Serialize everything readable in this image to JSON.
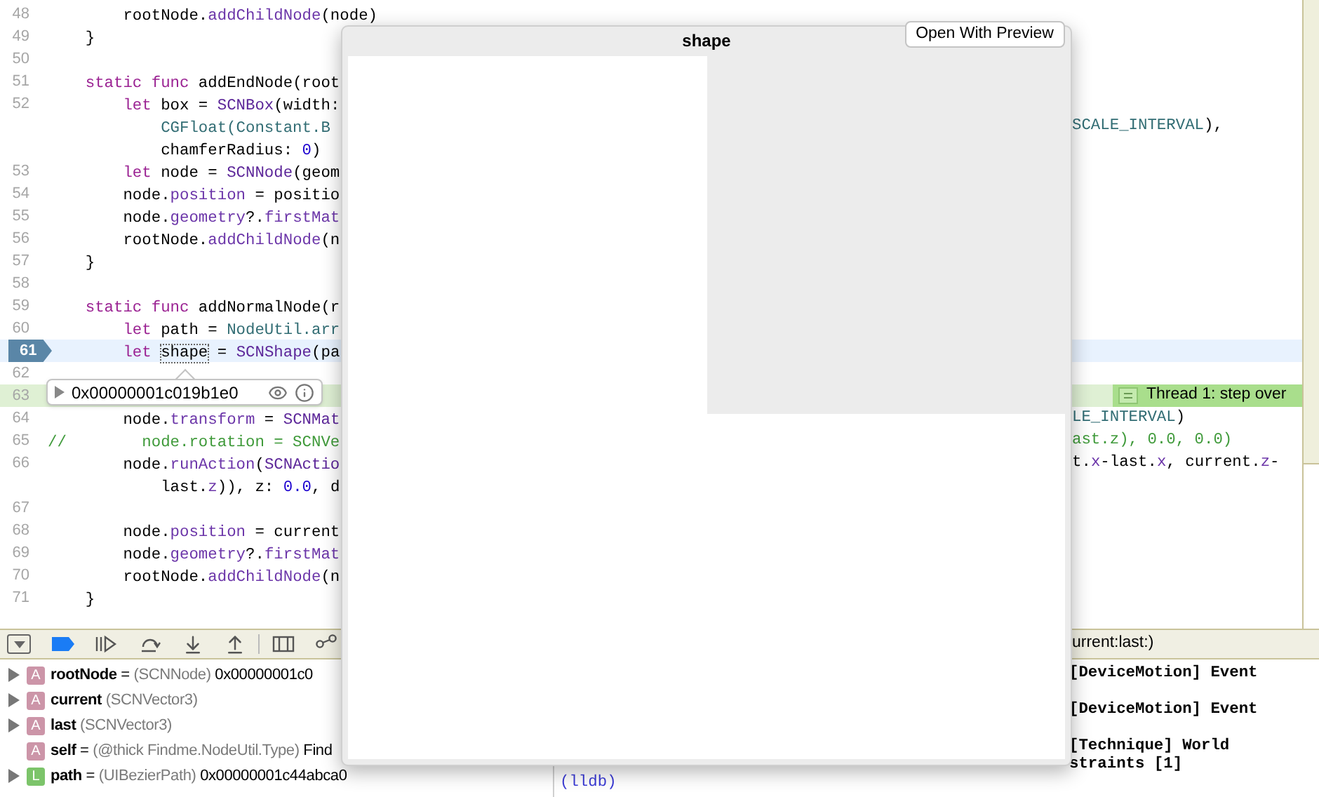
{
  "editor": {
    "lines": [
      {
        "number": "48",
        "code": [
          {
            "kind": "plain",
            "t": "        rootNode."
          },
          {
            "kind": "member",
            "t": "addChildNode"
          },
          {
            "kind": "plain",
            "t": "(node)"
          }
        ]
      },
      {
        "number": "49",
        "code": [
          {
            "kind": "plain",
            "t": "    }"
          }
        ]
      },
      {
        "number": "50"
      },
      {
        "number": "51",
        "code": [
          {
            "kind": "keyword",
            "t": "    static func"
          },
          {
            "kind": "plain",
            "t": " addEndNode(root"
          }
        ]
      },
      {
        "number": "52",
        "code": [
          {
            "kind": "keyword",
            "t": "        let"
          },
          {
            "kind": "plain",
            "t": " box = "
          },
          {
            "kind": "type",
            "t": "SCNBox"
          },
          {
            "kind": "plain",
            "t": "(width:"
          }
        ]
      },
      {
        "code": [
          {
            "kind": "project",
            "t": "            CGFloat(Constant.B"
          }
        ],
        "right": [
          {
            "kind": "project",
            "t": "SCALE_INTERVAL"
          },
          {
            "kind": "plain",
            "t": "),"
          }
        ]
      },
      {
        "code": [
          {
            "kind": "plain",
            "t": "            chamferRadius: "
          },
          {
            "kind": "number",
            "t": "0"
          },
          {
            "kind": "plain",
            "t": ")"
          }
        ]
      },
      {
        "number": "53",
        "code": [
          {
            "kind": "keyword",
            "t": "        let"
          },
          {
            "kind": "plain",
            "t": " node = "
          },
          {
            "kind": "type",
            "t": "SCNNode"
          },
          {
            "kind": "plain",
            "t": "(geom"
          }
        ]
      },
      {
        "number": "54",
        "code": [
          {
            "kind": "plain",
            "t": "        node."
          },
          {
            "kind": "member",
            "t": "position"
          },
          {
            "kind": "plain",
            "t": " = positio"
          }
        ]
      },
      {
        "number": "55",
        "code": [
          {
            "kind": "plain",
            "t": "        node."
          },
          {
            "kind": "member",
            "t": "geometry"
          },
          {
            "kind": "plain",
            "t": "?."
          },
          {
            "kind": "member",
            "t": "firstMat"
          }
        ]
      },
      {
        "number": "56",
        "code": [
          {
            "kind": "plain",
            "t": "        rootNode."
          },
          {
            "kind": "member",
            "t": "addChildNode"
          },
          {
            "kind": "plain",
            "t": "(n"
          }
        ]
      },
      {
        "number": "57",
        "code": [
          {
            "kind": "plain",
            "t": "    }"
          }
        ]
      },
      {
        "number": "58"
      },
      {
        "number": "59",
        "code": [
          {
            "kind": "keyword",
            "t": "    static func"
          },
          {
            "kind": "plain",
            "t": " addNormalNode(r"
          }
        ]
      },
      {
        "number": "60",
        "code": [
          {
            "kind": "keyword",
            "t": "        let"
          },
          {
            "kind": "plain",
            "t": " path = "
          },
          {
            "kind": "project",
            "t": "NodeUtil.arr"
          }
        ]
      },
      {
        "number": "61",
        "pc": true,
        "code": [
          {
            "kind": "keyword",
            "t": "        let "
          },
          {
            "kind": "hover",
            "t": "shape"
          },
          {
            "kind": "plain",
            "t": " = "
          },
          {
            "kind": "type",
            "t": "SCNShape"
          },
          {
            "kind": "plain",
            "t": "(pa"
          }
        ]
      },
      {
        "number": "62"
      },
      {
        "number": "63",
        "thread": "Thread 1: step over"
      },
      {
        "number": "64",
        "code": [
          {
            "kind": "plain",
            "t": "        node."
          },
          {
            "kind": "member",
            "t": "transform"
          },
          {
            "kind": "plain",
            "t": " = "
          },
          {
            "kind": "type",
            "t": "SCNMat"
          }
        ],
        "right": [
          {
            "kind": "project",
            "t": "LE_INTERVAL"
          },
          {
            "kind": "plain",
            "t": ")"
          }
        ]
      },
      {
        "number": "65",
        "code": [
          {
            "kind": "comment",
            "t": "//        node.rotation = SCNVe"
          }
        ],
        "right": [
          {
            "kind": "comment",
            "t": "ast.z), 0.0, 0.0)"
          }
        ]
      },
      {
        "number": "66",
        "code": [
          {
            "kind": "plain",
            "t": "        node."
          },
          {
            "kind": "member",
            "t": "runAction"
          },
          {
            "kind": "plain",
            "t": "("
          },
          {
            "kind": "type",
            "t": "SCNActio"
          }
        ],
        "right": [
          {
            "kind": "plain",
            "t": "t."
          },
          {
            "kind": "member",
            "t": "x"
          },
          {
            "kind": "plain",
            "t": "-last."
          },
          {
            "kind": "member",
            "t": "x"
          },
          {
            "kind": "plain",
            "t": ", current."
          },
          {
            "kind": "member",
            "t": "z"
          },
          {
            "kind": "plain",
            "t": "-"
          }
        ]
      },
      {
        "code": [
          {
            "kind": "plain",
            "t": "            last."
          },
          {
            "kind": "member",
            "t": "z"
          },
          {
            "kind": "plain",
            "t": ")), z: "
          },
          {
            "kind": "number",
            "t": "0.0"
          },
          {
            "kind": "plain",
            "t": ", d"
          }
        ]
      },
      {
        "number": "67"
      },
      {
        "number": "68",
        "code": [
          {
            "kind": "plain",
            "t": "        node."
          },
          {
            "kind": "member",
            "t": "position"
          },
          {
            "kind": "plain",
            "t": " = current"
          }
        ]
      },
      {
        "number": "69",
        "code": [
          {
            "kind": "plain",
            "t": "        node."
          },
          {
            "kind": "member",
            "t": "geometry"
          },
          {
            "kind": "plain",
            "t": "?."
          },
          {
            "kind": "member",
            "t": "firstMat"
          }
        ]
      },
      {
        "number": "70",
        "code": [
          {
            "kind": "plain",
            "t": "        rootNode."
          },
          {
            "kind": "member",
            "t": "addChildNode"
          },
          {
            "kind": "plain",
            "t": "(n"
          }
        ]
      },
      {
        "number": "71",
        "code": [
          {
            "kind": "plain",
            "t": "    }"
          }
        ]
      }
    ]
  },
  "value_popover": {
    "value": "0x00000001c019b1e0"
  },
  "debug_bar": {
    "breadcrumb": "urrent:last:)"
  },
  "variables": [
    {
      "expandable": true,
      "badge": "A",
      "color": "#cc95a8",
      "name": "rootNode",
      "sep": "=",
      "type": "(SCNNode)",
      "value": "0x00000001c0"
    },
    {
      "expandable": true,
      "badge": "A",
      "color": "#cc95a8",
      "name": "current",
      "type": "(SCNVector3)"
    },
    {
      "expandable": true,
      "badge": "A",
      "color": "#cc95a8",
      "name": "last",
      "type": "(SCNVector3)"
    },
    {
      "expandable": false,
      "badge": "A",
      "color": "#cc95a8",
      "name": "self",
      "sep": "=",
      "type": "(@thick Findme.NodeUtil.Type)",
      "value": "Find"
    },
    {
      "expandable": true,
      "badge": "L",
      "color": "#7cc46a",
      "name": "path",
      "sep": "=",
      "type": "(UIBezierPath)",
      "value": "0x00000001c44abca0"
    }
  ],
  "console": [
    {
      "kind": "log",
      "text": "[DeviceMotion] Event"
    },
    {
      "kind": "log",
      "text": "[DeviceMotion] Event"
    },
    {
      "kind": "log",
      "text": "[Technique] World"
    },
    {
      "kind": "log",
      "text": "straints [1]"
    },
    {
      "kind": "prompt",
      "text": "(lldb)"
    }
  ],
  "quick_look": {
    "title": "shape",
    "button": "Open With Preview"
  }
}
